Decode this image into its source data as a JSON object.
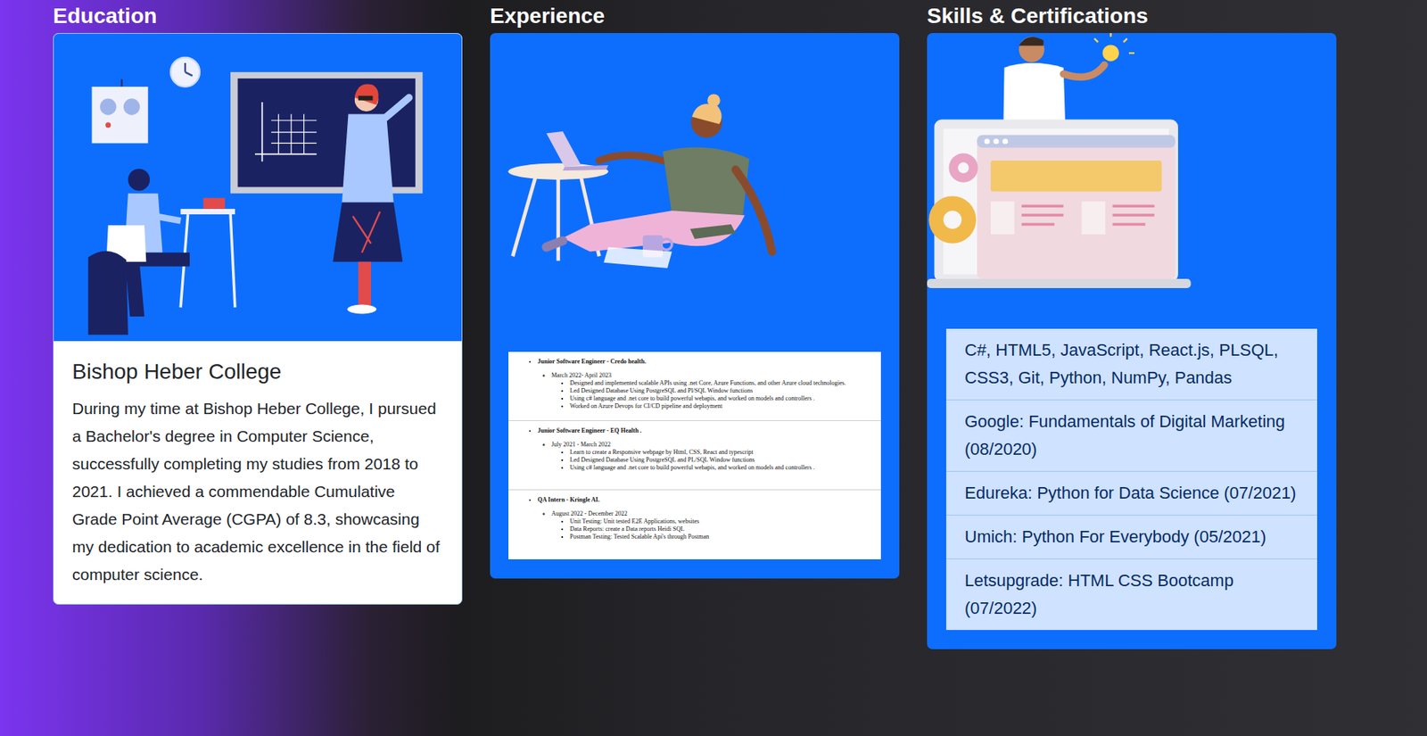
{
  "education": {
    "heading": "Education",
    "title": "Bishop Heber College",
    "text": "During my time at Bishop Heber College, I pursued a Bachelor's degree in Computer Science, successfully completing my studies from 2018 to 2021. I achieved a commendable Cumulative Grade Point Average (CGPA) of 8.3, showcasing my dedication to academic excellence in the field of computer science."
  },
  "experience": {
    "heading": "Experience",
    "jobs": [
      {
        "role": "Junior Software Engineer - Credo health.",
        "dates": "March 2022- April 2023",
        "points": [
          "Designed and implemented scalable APIs using .net Core, Azure Functions, and other Azure cloud technologies.",
          "Led Designed Database Using PostgreSQL and Pl/SQL Window functions",
          "Using c# language and .net core to build powerful webapis, and worked on models and controllers .",
          "Worked on Azure Devops for CI/CD pipeline and deployment"
        ]
      },
      {
        "role": "Junior Software Engineer - EQ Health .",
        "dates": "July 2021 - March 2022",
        "points": [
          "Learn to create a Responsive webpage by Html, CSS, React and typescript",
          "Led Designed Database Using PostgreSQL and PL/SQL Window functions",
          "Using c# language and .net core to build powerful webapis, and worked on models and controllers ."
        ]
      },
      {
        "role": "QA Intern - Kringle AI.",
        "dates": "August 2022 - December 2022",
        "points": [
          "Unit Testing: Unit tested E2E Applications, websites",
          "Data Reports: create a Data reports Heidi SQL",
          "Postman Testing: Tested Scalable Api's through Postman"
        ]
      }
    ]
  },
  "skills": {
    "heading": "Skills & Certifications",
    "items": [
      "C#, HTML5, JavaScript, React.js, PLSQL, CSS3, Git, Python, NumPy, Pandas",
      "Google: Fundamentals of Digital Marketing (08/2020)",
      "Edureka: Python for Data Science (07/2021)",
      "Umich: Python For Everybody (05/2021)",
      "Letsupgrade: HTML CSS Bootcamp (07/2022)"
    ]
  }
}
